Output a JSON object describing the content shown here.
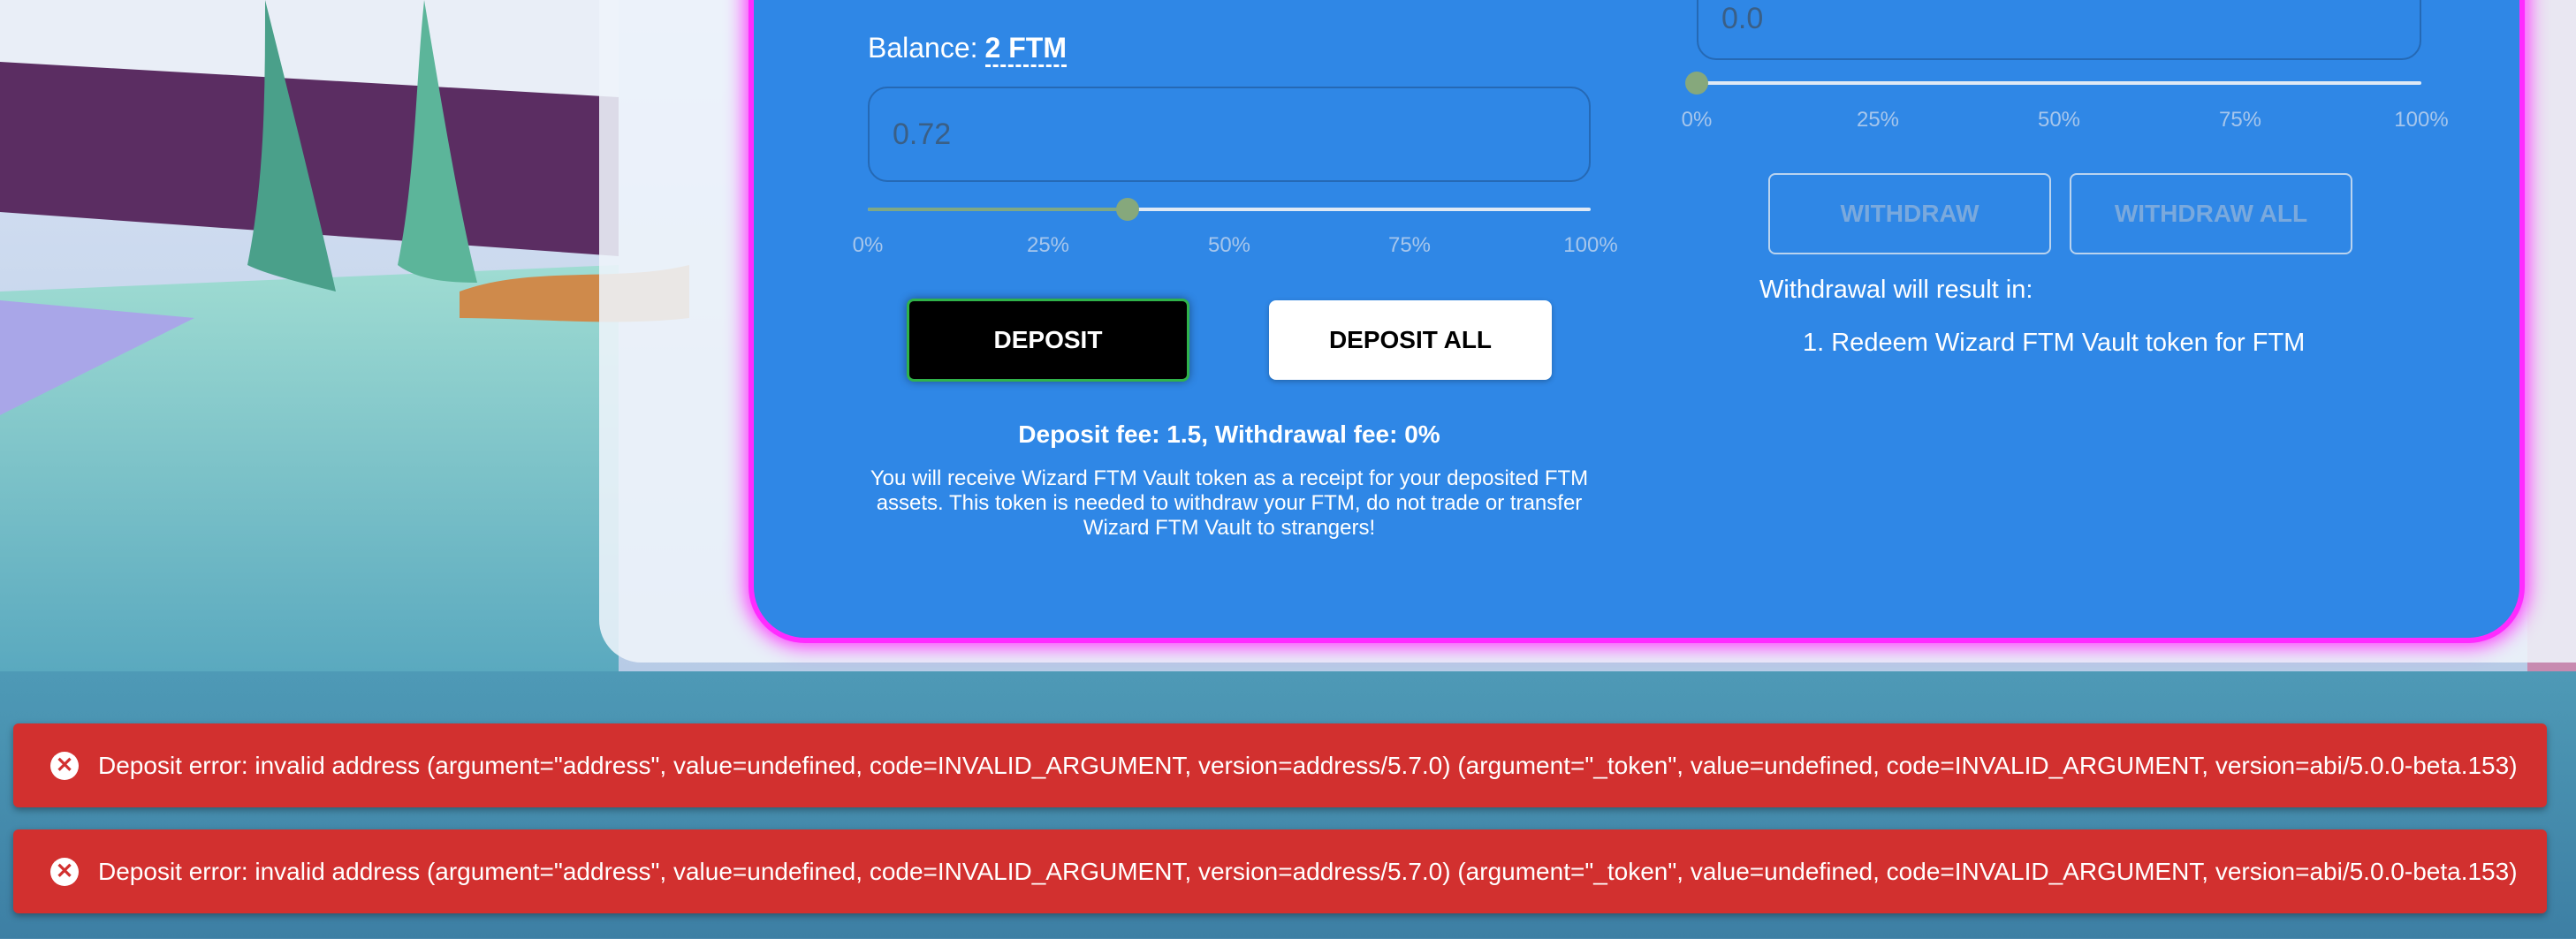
{
  "deposit": {
    "balance_label": "Balance:",
    "balance_value": "2 FTM",
    "input_value": "0.72",
    "slider_percent": 36,
    "slider_ticks": [
      "0%",
      "25%",
      "50%",
      "75%",
      "100%"
    ],
    "deposit_label": "DEPOSIT",
    "deposit_all_label": "DEPOSIT ALL",
    "fee_text": "Deposit fee: 1.5, Withdrawal fee: 0%",
    "note": "You will receive Wizard FTM Vault token as a receipt for your deposited FTM assets. This token is needed to withdraw your FTM, do not trade or transfer Wizard FTM Vault to strangers!"
  },
  "withdraw": {
    "input_value": "0.0",
    "slider_percent": 0,
    "slider_ticks": [
      "0%",
      "25%",
      "50%",
      "75%",
      "100%"
    ],
    "withdraw_label": "WITHDRAW",
    "withdraw_all_label": "WITHDRAW ALL",
    "result_title": "Withdrawal will result in:",
    "result_item": "1. Redeem Wizard FTM Vault token for FTM"
  },
  "toasts": [
    {
      "icon": "close-circle-icon",
      "message": "Deposit error: invalid address (argument=\"address\", value=undefined, code=INVALID_ARGUMENT, version=address/5.7.0) (argument=\"_token\", value=undefined, code=INVALID_ARGUMENT, version=abi/5.0.0-beta.153)"
    },
    {
      "icon": "close-circle-icon",
      "message": "Deposit error: invalid address (argument=\"address\", value=undefined, code=INVALID_ARGUMENT, version=address/5.7.0) (argument=\"_token\", value=undefined, code=INVALID_ARGUMENT, version=abi/5.0.0-beta.153)"
    }
  ],
  "colors": {
    "card": "#2f87e6",
    "card_glow": "#ff2bff",
    "error": "#d2302f",
    "deposit_button": "#000000"
  }
}
